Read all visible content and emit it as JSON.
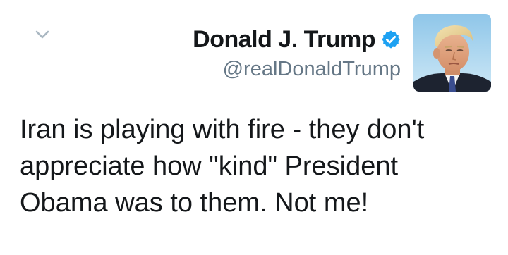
{
  "tweet": {
    "author": {
      "display_name": "Donald J. Trump",
      "handle": "@realDonaldTrump",
      "verified": true,
      "verified_icon": "verified-badge-icon"
    },
    "text": "Iran is playing with fire - they don't\nappreciate how \"kind\" President\nObama was to them. Not me!",
    "menu_icon": "chevron-down-icon"
  },
  "colors": {
    "name": "#14171a",
    "handle": "#657786",
    "verified": "#1da1f2",
    "chevron": "#aab8c2",
    "background": "#ffffff"
  }
}
